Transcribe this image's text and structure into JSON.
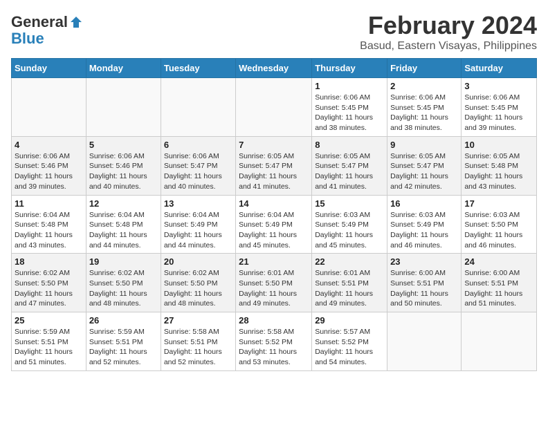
{
  "header": {
    "logo_line1": "General",
    "logo_line2": "Blue",
    "month": "February 2024",
    "location": "Basud, Eastern Visayas, Philippines"
  },
  "days_of_week": [
    "Sunday",
    "Monday",
    "Tuesday",
    "Wednesday",
    "Thursday",
    "Friday",
    "Saturday"
  ],
  "weeks": [
    [
      {
        "day": "",
        "info": ""
      },
      {
        "day": "",
        "info": ""
      },
      {
        "day": "",
        "info": ""
      },
      {
        "day": "",
        "info": ""
      },
      {
        "day": "1",
        "info": "Sunrise: 6:06 AM\nSunset: 5:45 PM\nDaylight: 11 hours\nand 38 minutes."
      },
      {
        "day": "2",
        "info": "Sunrise: 6:06 AM\nSunset: 5:45 PM\nDaylight: 11 hours\nand 38 minutes."
      },
      {
        "day": "3",
        "info": "Sunrise: 6:06 AM\nSunset: 5:45 PM\nDaylight: 11 hours\nand 39 minutes."
      }
    ],
    [
      {
        "day": "4",
        "info": "Sunrise: 6:06 AM\nSunset: 5:46 PM\nDaylight: 11 hours\nand 39 minutes."
      },
      {
        "day": "5",
        "info": "Sunrise: 6:06 AM\nSunset: 5:46 PM\nDaylight: 11 hours\nand 40 minutes."
      },
      {
        "day": "6",
        "info": "Sunrise: 6:06 AM\nSunset: 5:47 PM\nDaylight: 11 hours\nand 40 minutes."
      },
      {
        "day": "7",
        "info": "Sunrise: 6:05 AM\nSunset: 5:47 PM\nDaylight: 11 hours\nand 41 minutes."
      },
      {
        "day": "8",
        "info": "Sunrise: 6:05 AM\nSunset: 5:47 PM\nDaylight: 11 hours\nand 41 minutes."
      },
      {
        "day": "9",
        "info": "Sunrise: 6:05 AM\nSunset: 5:47 PM\nDaylight: 11 hours\nand 42 minutes."
      },
      {
        "day": "10",
        "info": "Sunrise: 6:05 AM\nSunset: 5:48 PM\nDaylight: 11 hours\nand 43 minutes."
      }
    ],
    [
      {
        "day": "11",
        "info": "Sunrise: 6:04 AM\nSunset: 5:48 PM\nDaylight: 11 hours\nand 43 minutes."
      },
      {
        "day": "12",
        "info": "Sunrise: 6:04 AM\nSunset: 5:48 PM\nDaylight: 11 hours\nand 44 minutes."
      },
      {
        "day": "13",
        "info": "Sunrise: 6:04 AM\nSunset: 5:49 PM\nDaylight: 11 hours\nand 44 minutes."
      },
      {
        "day": "14",
        "info": "Sunrise: 6:04 AM\nSunset: 5:49 PM\nDaylight: 11 hours\nand 45 minutes."
      },
      {
        "day": "15",
        "info": "Sunrise: 6:03 AM\nSunset: 5:49 PM\nDaylight: 11 hours\nand 45 minutes."
      },
      {
        "day": "16",
        "info": "Sunrise: 6:03 AM\nSunset: 5:49 PM\nDaylight: 11 hours\nand 46 minutes."
      },
      {
        "day": "17",
        "info": "Sunrise: 6:03 AM\nSunset: 5:50 PM\nDaylight: 11 hours\nand 46 minutes."
      }
    ],
    [
      {
        "day": "18",
        "info": "Sunrise: 6:02 AM\nSunset: 5:50 PM\nDaylight: 11 hours\nand 47 minutes."
      },
      {
        "day": "19",
        "info": "Sunrise: 6:02 AM\nSunset: 5:50 PM\nDaylight: 11 hours\nand 48 minutes."
      },
      {
        "day": "20",
        "info": "Sunrise: 6:02 AM\nSunset: 5:50 PM\nDaylight: 11 hours\nand 48 minutes."
      },
      {
        "day": "21",
        "info": "Sunrise: 6:01 AM\nSunset: 5:50 PM\nDaylight: 11 hours\nand 49 minutes."
      },
      {
        "day": "22",
        "info": "Sunrise: 6:01 AM\nSunset: 5:51 PM\nDaylight: 11 hours\nand 49 minutes."
      },
      {
        "day": "23",
        "info": "Sunrise: 6:00 AM\nSunset: 5:51 PM\nDaylight: 11 hours\nand 50 minutes."
      },
      {
        "day": "24",
        "info": "Sunrise: 6:00 AM\nSunset: 5:51 PM\nDaylight: 11 hours\nand 51 minutes."
      }
    ],
    [
      {
        "day": "25",
        "info": "Sunrise: 5:59 AM\nSunset: 5:51 PM\nDaylight: 11 hours\nand 51 minutes."
      },
      {
        "day": "26",
        "info": "Sunrise: 5:59 AM\nSunset: 5:51 PM\nDaylight: 11 hours\nand 52 minutes."
      },
      {
        "day": "27",
        "info": "Sunrise: 5:58 AM\nSunset: 5:51 PM\nDaylight: 11 hours\nand 52 minutes."
      },
      {
        "day": "28",
        "info": "Sunrise: 5:58 AM\nSunset: 5:52 PM\nDaylight: 11 hours\nand 53 minutes."
      },
      {
        "day": "29",
        "info": "Sunrise: 5:57 AM\nSunset: 5:52 PM\nDaylight: 11 hours\nand 54 minutes."
      },
      {
        "day": "",
        "info": ""
      },
      {
        "day": "",
        "info": ""
      }
    ]
  ]
}
